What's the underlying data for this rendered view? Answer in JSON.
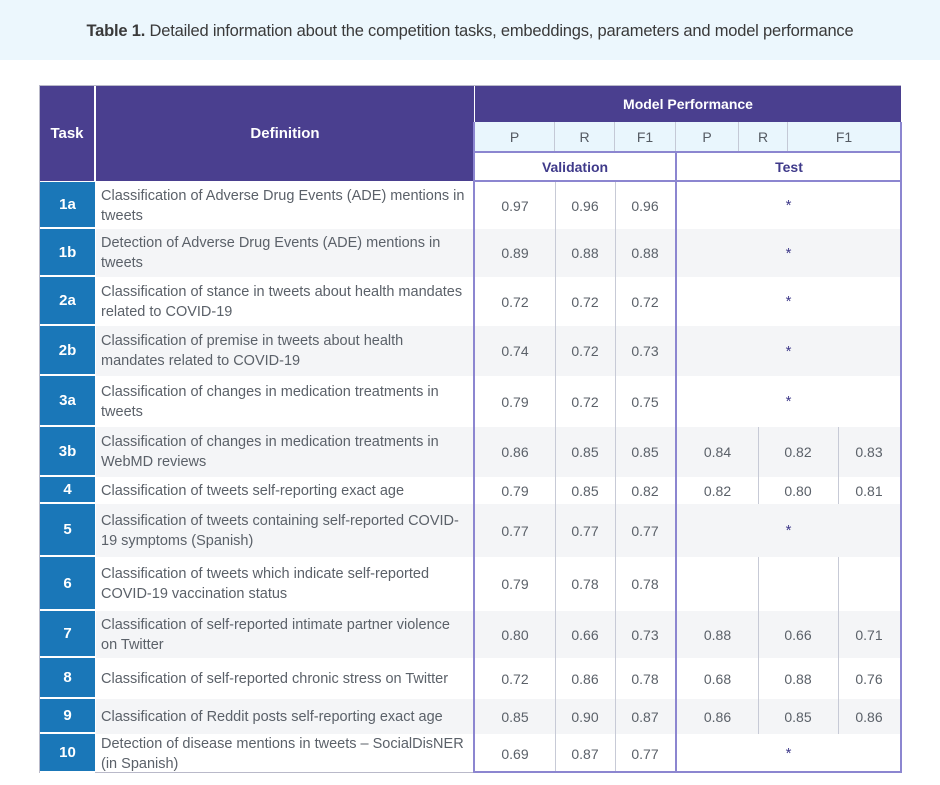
{
  "caption": {
    "label": "Table 1.",
    "text": " Detailed information about  the competition tasks,  embeddings,  parameters and model performance"
  },
  "header": {
    "task": "Task",
    "definition": "Definition",
    "model_performance": "Model Performance",
    "metric_labels": [
      "P",
      "R",
      "F1",
      "P",
      "R",
      "F1"
    ],
    "validation": "Validation",
    "test": "Test"
  },
  "rows": [
    {
      "task": "1a",
      "definition": "Classification of Adverse Drug Events (ADE) mentions in tweets",
      "val": [
        "0.97",
        "0.96",
        "0.96"
      ],
      "test": [
        "*"
      ]
    },
    {
      "task": "1b",
      "definition": "Detection of Adverse Drug Events (ADE) mentions in tweets",
      "val": [
        "0.89",
        "0.88",
        "0.88"
      ],
      "test": [
        "*"
      ]
    },
    {
      "task": "2a",
      "definition": "Classification of stance in tweets about health mandates related to COVID-19",
      "val": [
        "0.72",
        "0.72",
        "0.72"
      ],
      "test": [
        "*"
      ]
    },
    {
      "task": "2b",
      "definition": "Classification of premise in tweets about health mandates related to COVID-19",
      "val": [
        "0.74",
        "0.72",
        "0.73"
      ],
      "test": [
        "*"
      ]
    },
    {
      "task": "3a",
      "definition": "Classification of changes in medication treatments in tweets",
      "val": [
        "0.79",
        "0.72",
        "0.75"
      ],
      "test": [
        "*"
      ]
    },
    {
      "task": "3b",
      "definition": "Classification of changes in medication treatments in WebMD reviews",
      "val": [
        "0.86",
        "0.85",
        "0.85"
      ],
      "test": [
        "0.84",
        "0.82",
        "0.83"
      ]
    },
    {
      "task": "4",
      "definition": "Classification of tweets self-reporting exact age",
      "val": [
        "0.79",
        "0.85",
        "0.82"
      ],
      "test": [
        "0.82",
        "0.80",
        "0.81"
      ]
    },
    {
      "task": "5",
      "definition": "Classification of tweets containing self-reported COVID-19 symptoms (Spanish)",
      "val": [
        "0.77",
        "0.77",
        "0.77"
      ],
      "test": [
        "*"
      ]
    },
    {
      "task": "6",
      "definition": "Classification of tweets which indicate self-reported COVID-19 vaccination status",
      "val": [
        "0.79",
        "0.78",
        "0.78"
      ],
      "test": [
        "",
        "",
        ""
      ]
    },
    {
      "task": "7",
      "definition": "Classification of self-reported intimate partner violence on Twitter",
      "val": [
        "0.80",
        "0.66",
        "0.73"
      ],
      "test": [
        "0.88",
        "0.66",
        "0.71"
      ]
    },
    {
      "task": "8",
      "definition": "Classification of self-reported chronic stress on Twitter",
      "val": [
        "0.72",
        "0.86",
        "0.78"
      ],
      "test": [
        "0.68",
        "0.88",
        "0.76"
      ]
    },
    {
      "task": "9",
      "definition": "Classification of Reddit posts self-reporting exact age",
      "val": [
        "0.85",
        "0.90",
        "0.87"
      ],
      "test": [
        "0.86",
        "0.85",
        "0.86"
      ]
    },
    {
      "task": "10",
      "definition": "Detection of disease mentions in tweets – SocialDisNER (in Spanish)",
      "val": [
        "0.69",
        "0.87",
        "0.77"
      ],
      "test": [
        "*"
      ]
    }
  ]
}
